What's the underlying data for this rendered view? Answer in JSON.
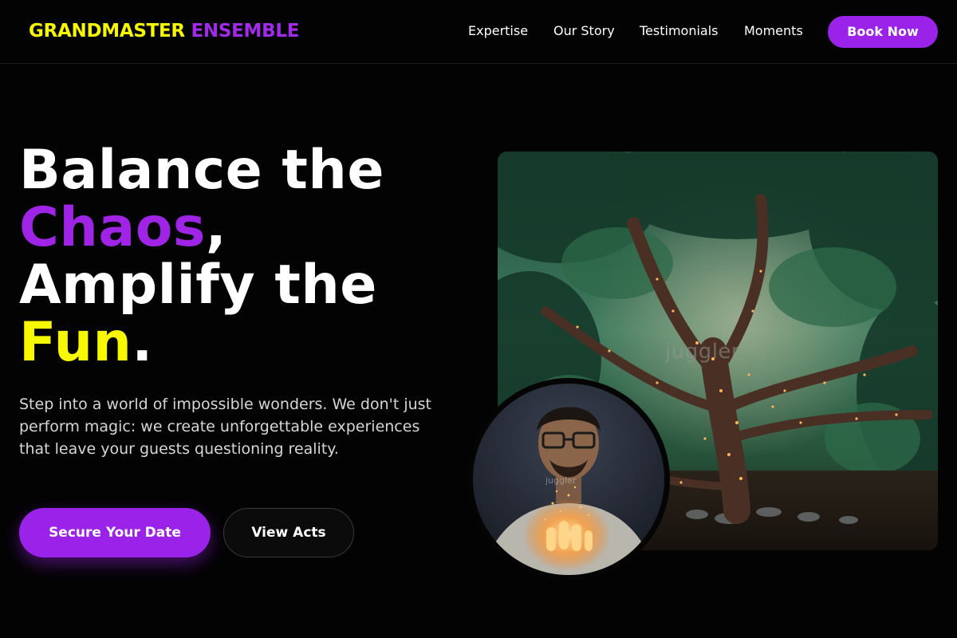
{
  "header": {
    "logo_part1": "GRANDMASTER",
    "logo_part2": "ENSEMBLE",
    "nav": [
      "Expertise",
      "Our Story",
      "Testimonials",
      "Moments"
    ],
    "book_label": "Book Now"
  },
  "hero": {
    "title_line1": "Balance the",
    "title_word2": "Chaos",
    "title_punct2": ",",
    "title_line3": "Amplify the",
    "title_word4": "Fun",
    "title_punct4": ".",
    "subtitle": "Step into a world of impossible wonders. We don't just perform magic: we create unforgettable experiences that leave your guests questioning reality.",
    "primary_cta": "Secure Your Date",
    "secondary_cta": "View Acts",
    "image_watermark": "juggler",
    "avatar_watermark": "juggler"
  },
  "colors": {
    "accent_purple": "#9b22e8",
    "accent_yellow": "#f7f700",
    "background": "#030303"
  },
  "icons": {
    "main_image": "tree-with-fairy-lights-photo",
    "avatar_image": "man-holding-sparks-photo"
  }
}
